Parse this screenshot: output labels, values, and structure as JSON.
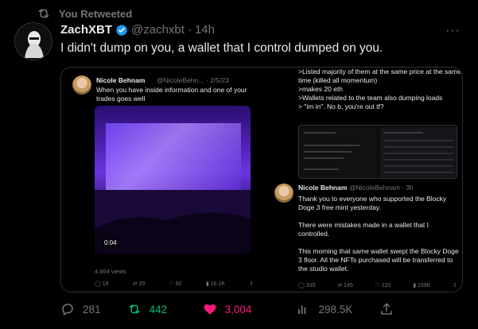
{
  "retweet_banner": {
    "label": "You Retweeted"
  },
  "tweet": {
    "author_name": "ZachXBT",
    "handle": "@zachxbt",
    "separator": "·",
    "time": "14h",
    "text": "I didn't dump on you, a wallet that I control dumped on you.",
    "more_icon": "more-horizontal-icon"
  },
  "media": {
    "left": {
      "name": "Nicole Behnam",
      "handle": "@NicoleBehn...",
      "date": "· 2/5/23",
      "text": "When you have inside information and one of your trades goes well",
      "video_time": "0:04",
      "views": "4,664 views",
      "actions": {
        "replies": "18",
        "retweets": "20",
        "likes": "82",
        "views": "16.1K"
      }
    },
    "right": {
      "text_lines": [
        ">Listed majority of them at the same price at the same time (killed all momentum)",
        ">makes 20 eth",
        ">Wallets related to the team also dumping loads",
        "> \"im in\". No b, you're out tf?"
      ],
      "quoted": {
        "name": "Nicole Behnam",
        "handle": "@NicoleBehnam",
        "time": "· 3h",
        "paragraphs": [
          "Thank you to everyone who supported the Blocky Doge 3 free mint yesterday.",
          "There were mistakes made in a wallet that I controlled.",
          "This morning that same wallet swept the Blocky Doge 3 floor. All the NFTs purchased will be transferred to the studio wallet."
        ],
        "actions": {
          "replies": "335",
          "retweets": "145",
          "likes": "120",
          "views": "159K"
        }
      }
    }
  },
  "actions": {
    "replies": "281",
    "retweets": "442",
    "likes": "3,004",
    "views": "298.5K"
  },
  "colors": {
    "background": "#000000",
    "text": "#e7e9ea",
    "muted": "#71767b",
    "retweet_green": "#00ba7c",
    "like_pink": "#f91880",
    "verified_blue": "#1d9bf0"
  }
}
